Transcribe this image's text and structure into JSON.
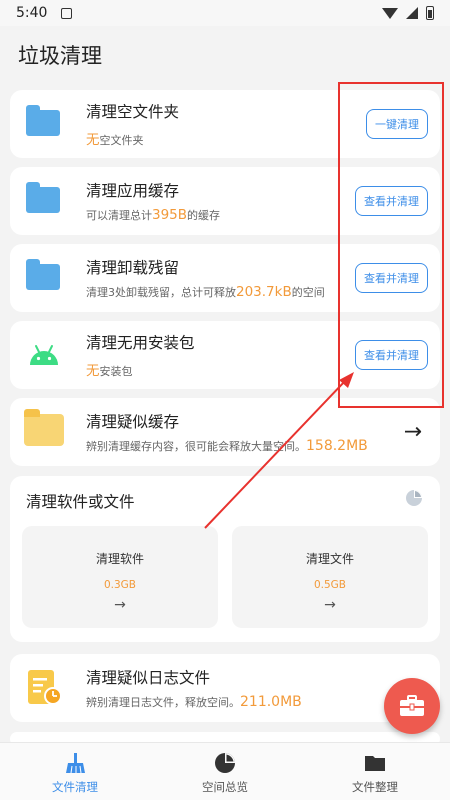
{
  "status_bar": {
    "time": "5:40"
  },
  "page": {
    "title": "垃圾清理"
  },
  "items": [
    {
      "title": "清理空文件夹",
      "sub_hl": "无",
      "sub_after": "空文件夹",
      "button": "一键清理"
    },
    {
      "title": "清理应用缓存",
      "sub_before": "可以清理总计",
      "sub_hl": "395B",
      "sub_after": "的缓存",
      "button": "查看并清理"
    },
    {
      "title": "清理卸载残留",
      "sub_before": "清理3处卸载残留，总计可释放",
      "sub_hl": "203.7kB",
      "sub_after": "的空间",
      "button": "查看并清理"
    },
    {
      "title": "清理无用安装包",
      "sub_hl": "无",
      "sub_after": "安装包",
      "button": "查看并清理"
    },
    {
      "title": "清理疑似缓存",
      "sub_before": "辨别清理缓存内容，很可能会释放大量空间。",
      "sub_hl": "158.2MB"
    }
  ],
  "software_section": {
    "title": "清理软件或文件",
    "boxes": [
      {
        "title": "清理软件",
        "value": "0.3GB",
        "arrow": "→"
      },
      {
        "title": "清理文件",
        "value": "0.5GB",
        "arrow": "→"
      }
    ]
  },
  "log_item": {
    "title": "清理疑似日志文件",
    "sub_before": "辨别清理日志文件，释放空间。",
    "sub_hl": "211.0MB"
  },
  "bottom_nav": [
    {
      "label": "文件清理",
      "active": true
    },
    {
      "label": "空间总览",
      "active": false
    },
    {
      "label": "文件整理",
      "active": false
    }
  ],
  "colors": {
    "accent": "#3d8ee8",
    "highlight": "#f29a3a",
    "annotation": "#e8322e",
    "fab": "#ee5a4f"
  },
  "icons": [
    "folder-icon",
    "android-icon",
    "yellow-folder-icon",
    "pie-chart-icon",
    "log-file-icon",
    "toolbox-icon",
    "broom-icon",
    "folder-nav-icon"
  ]
}
